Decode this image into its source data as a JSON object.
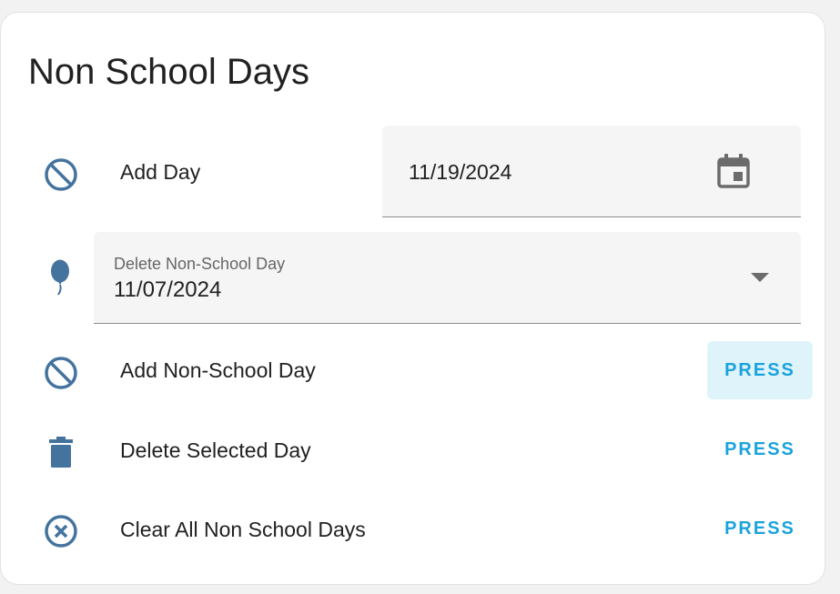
{
  "card": {
    "title": "Non School Days"
  },
  "add_day": {
    "icon": "cancel-circle-icon",
    "label": "Add Day",
    "date_value": "11/19/2024",
    "calendar_icon": "calendar-icon"
  },
  "delete_select": {
    "icon": "balloon-icon",
    "label": "Delete Non-School Day",
    "value": "11/07/2024",
    "arrow_icon": "dropdown-arrow-icon"
  },
  "buttons": [
    {
      "icon": "cancel-circle-icon",
      "label": "Add Non-School Day",
      "action": "PRESS"
    },
    {
      "icon": "trash-icon",
      "label": "Delete Selected Day",
      "action": "PRESS"
    },
    {
      "icon": "close-circle-icon",
      "label": "Clear All Non School Days",
      "action": "PRESS"
    }
  ],
  "colors": {
    "icon": "#44739e",
    "accent": "#1aa3dc",
    "field_bg": "#f5f5f5",
    "hover_bg": "#dff3fb"
  }
}
